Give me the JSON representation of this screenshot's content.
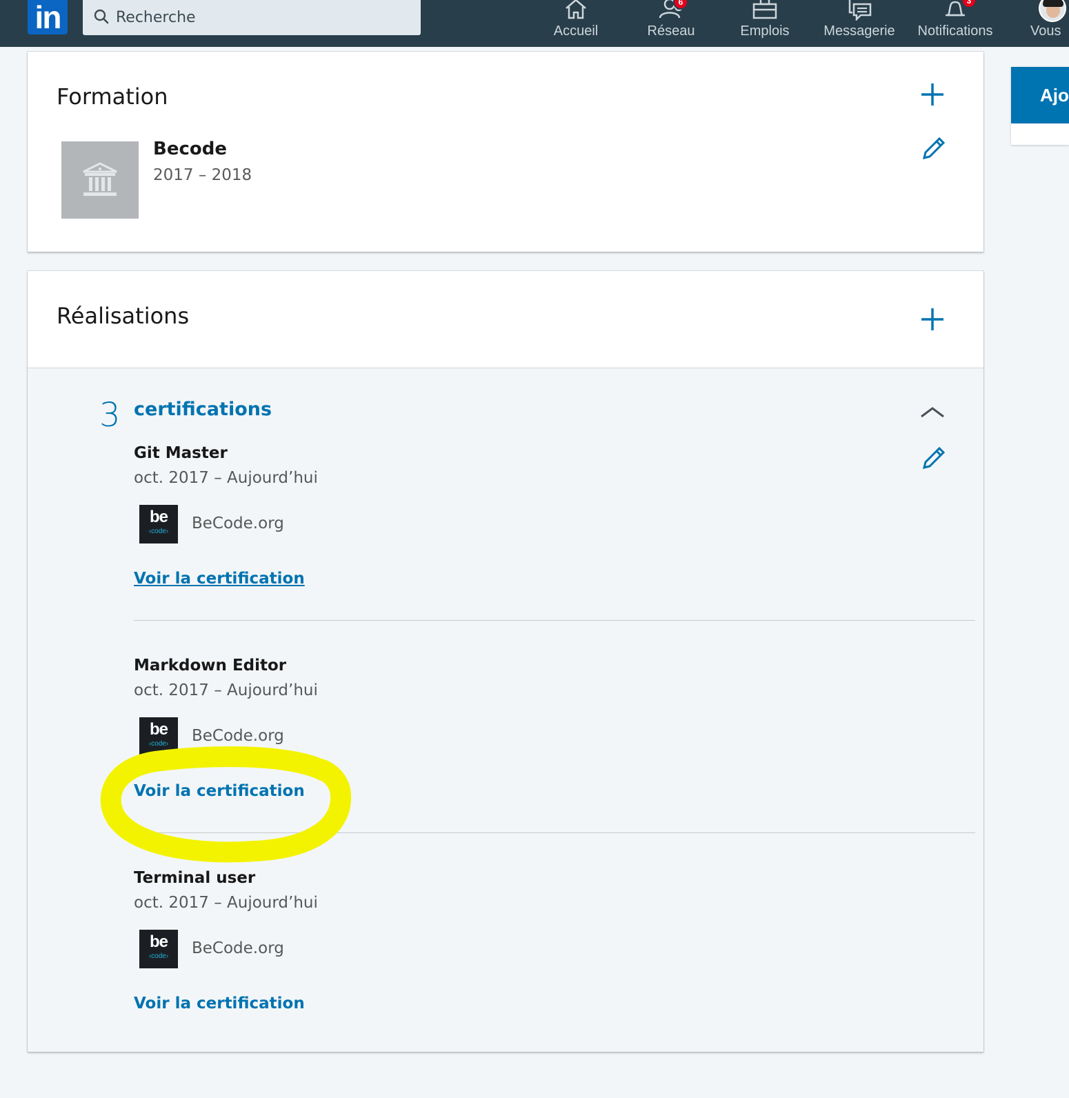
{
  "nav": {
    "logo": "in",
    "search_placeholder": "Recherche",
    "items": [
      {
        "label": "Accueil"
      },
      {
        "label": "Réseau",
        "badge": "6"
      },
      {
        "label": "Emplois"
      },
      {
        "label": "Messagerie"
      },
      {
        "label": "Notifications",
        "badge": "3"
      },
      {
        "label": "Vous"
      }
    ]
  },
  "right_panel": {
    "button_label": "Ajo"
  },
  "formation": {
    "title": "Formation",
    "school": "Becode",
    "dates": "2017 – 2018"
  },
  "realisations": {
    "title": "Réalisations",
    "count": "3",
    "count_label": "certifications",
    "certifications": [
      {
        "name": "Git Master",
        "dates": "oct. 2017 – Aujourd’hui",
        "issuer": "BeCode.org",
        "link": "Voir la certification",
        "logo_be": "be",
        "logo_code": "‹code›"
      },
      {
        "name": "Markdown Editor",
        "dates": "oct. 2017 – Aujourd’hui",
        "issuer": "BeCode.org",
        "link": "Voir la certification",
        "logo_be": "be",
        "logo_code": "‹code›"
      },
      {
        "name": "Terminal user",
        "dates": "oct. 2017 – Aujourd’hui",
        "issuer": "BeCode.org",
        "link": "Voir la certification",
        "logo_be": "be",
        "logo_code": "‹code›"
      }
    ]
  },
  "colors": {
    "navbar": "#283e4a",
    "accent": "#0073b1",
    "highlight": "#f3f300",
    "badge": "#e3001b"
  }
}
